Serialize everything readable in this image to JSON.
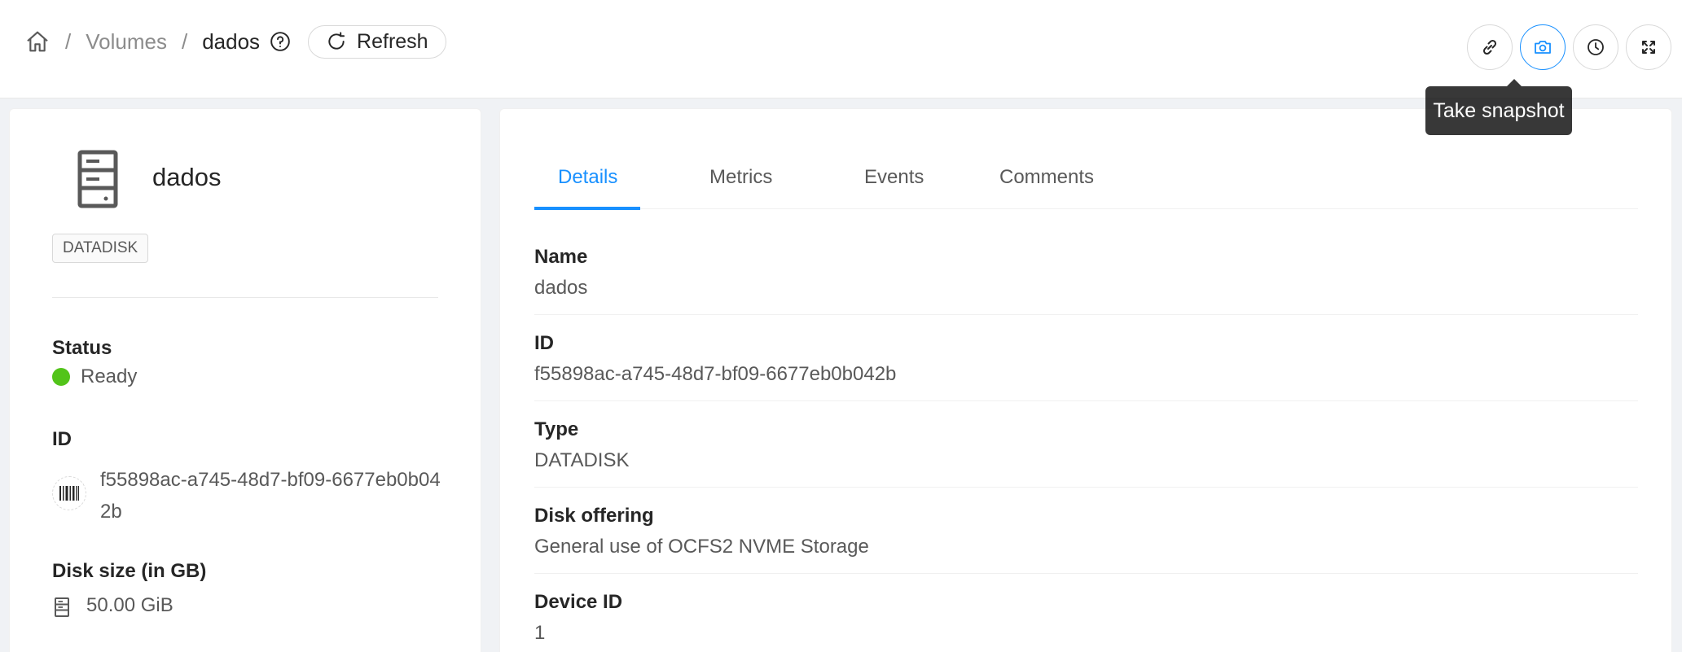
{
  "breadcrumb": {
    "home_icon": "home-icon",
    "section": "Volumes",
    "current": "dados",
    "separator": "/"
  },
  "toolbar": {
    "refresh_label": "Refresh",
    "actions": [
      "link-icon",
      "camera-icon",
      "clock-icon",
      "fullscreen-icon"
    ],
    "tooltip": "Take snapshot",
    "accent_color": "#1890ff"
  },
  "resource": {
    "name": "dados",
    "tag": "DATADISK",
    "status_label": "Status",
    "status": "Ready",
    "status_color": "#52c41a",
    "id_label": "ID",
    "id": "f55898ac-a745-48d7-bf09-6677eb0b042b",
    "disk_size_label": "Disk size (in GB)",
    "disk_size": "50.00 GiB"
  },
  "tabs": [
    "Details",
    "Metrics",
    "Events",
    "Comments"
  ],
  "details": [
    {
      "label": "Name",
      "value": "dados"
    },
    {
      "label": "ID",
      "value": "f55898ac-a745-48d7-bf09-6677eb0b042b"
    },
    {
      "label": "Type",
      "value": "DATADISK"
    },
    {
      "label": "Disk offering",
      "value": "General use of OCFS2 NVME Storage"
    },
    {
      "label": "Device ID",
      "value": "1"
    }
  ]
}
